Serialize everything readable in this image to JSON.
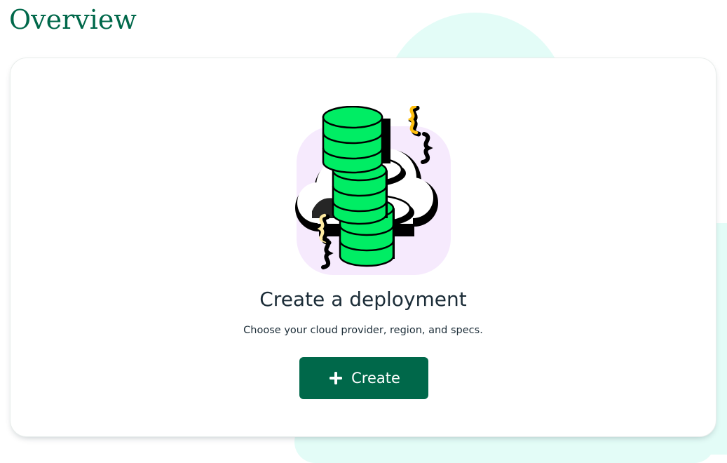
{
  "header": {
    "title": "Overview"
  },
  "empty_state": {
    "illustration_icon": "database-cloud-illustration",
    "heading": "Create a deployment",
    "description": "Choose your cloud provider, region, and specs.",
    "button": {
      "label": "Create",
      "icon": "plus-icon"
    }
  },
  "colors": {
    "brand_green": "#00684a",
    "text_dark": "#1c2d38",
    "accent_mint": "#e3fcf7",
    "illustration_green": "#00ed64",
    "illustration_lavender": "#f6eafd",
    "illustration_yellow": "#ffc010"
  }
}
